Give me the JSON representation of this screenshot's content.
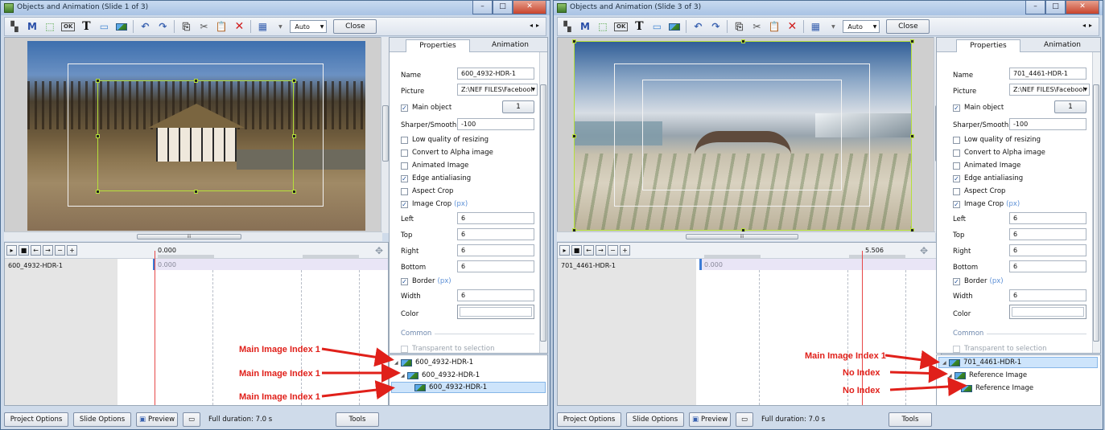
{
  "windows": [
    {
      "title": "Objects and Animation (Slide 1 of 3)",
      "toolbar": {
        "m_label": "M",
        "t_label": "T",
        "zoom_value": "Auto",
        "close_label": "Close"
      },
      "tabs": {
        "properties": "Properties",
        "animation": "Animation"
      },
      "props": {
        "name_label": "Name",
        "name_value": "600_4932-HDR-1",
        "picture_label": "Picture",
        "picture_value": "Z:\\NEF FILES\\Facebool",
        "main_object_label": "Main object",
        "main_object_index": "1",
        "sharper_label": "Sharper/Smooth...",
        "sharper_value": "-100",
        "low_quality": "Low quality of resizing",
        "convert_alpha": "Convert to Alpha image",
        "animated_image": "Animated Image",
        "edge_antialiasing": "Edge antialiasing",
        "aspect_crop": "Aspect Crop",
        "image_crop": "Image Crop",
        "px1": "(px)",
        "left_label": "Left",
        "left_value": "6",
        "top_label": "Top",
        "top_value": "6",
        "right_label": "Right",
        "right_value": "6",
        "bottom_label": "Bottom",
        "bottom_value": "6",
        "border_label": "Border",
        "px2": "(px)",
        "width_label": "Width",
        "width_value": "6",
        "color_label": "Color",
        "common_label": "Common",
        "transparent": "Transparent to selection"
      },
      "timeline": {
        "time": "0.000",
        "track_name": "600_4932-HDR-1",
        "track_time": "0.000"
      },
      "tree": [
        "600_4932-HDR-1",
        "600_4932-HDR-1",
        "600_4932-HDR-1"
      ],
      "annotations": [
        "Main Image Index 1",
        "Main Image Index 1",
        "Main Image Index 1"
      ],
      "bottom": {
        "project_options": "Project Options",
        "slide_options": "Slide Options",
        "preview": "Preview",
        "duration": "Full duration: 7.0 s",
        "tools": "Tools"
      }
    },
    {
      "title": "Objects and Animation (Slide 3 of 3)",
      "toolbar": {
        "m_label": "M",
        "t_label": "T",
        "zoom_value": "Auto",
        "close_label": "Close"
      },
      "tabs": {
        "properties": "Properties",
        "animation": "Animation"
      },
      "props": {
        "name_label": "Name",
        "name_value": "701_4461-HDR-1",
        "picture_label": "Picture",
        "picture_value": "Z:\\NEF FILES\\Facebool",
        "main_object_label": "Main object",
        "main_object_index": "1",
        "sharper_label": "Sharper/Smooth...",
        "sharper_value": "-100",
        "low_quality": "Low quality of resizing",
        "convert_alpha": "Convert to Alpha image",
        "animated_image": "Animated Image",
        "edge_antialiasing": "Edge antialiasing",
        "aspect_crop": "Aspect Crop",
        "image_crop": "Image Crop",
        "px1": "(px)",
        "left_label": "Left",
        "left_value": "6",
        "top_label": "Top",
        "top_value": "6",
        "right_label": "Right",
        "right_value": "6",
        "bottom_label": "Bottom",
        "bottom_value": "6",
        "border_label": "Border",
        "px2": "(px)",
        "width_label": "Width",
        "width_value": "6",
        "color_label": "Color",
        "common_label": "Common",
        "transparent": "Transparent to selection"
      },
      "timeline": {
        "time": "5.506",
        "track_name": "701_4461-HDR-1",
        "track_time": "0.000"
      },
      "tree": [
        "701_4461-HDR-1",
        "Reference Image",
        "Reference Image"
      ],
      "annotations": [
        "Main Image Index 1",
        "No Index",
        "No Index"
      ],
      "bottom": {
        "project_options": "Project Options",
        "slide_options": "Slide Options",
        "preview": "Preview",
        "duration": "Full duration: 7.0 s",
        "tools": "Tools"
      }
    }
  ],
  "colors": {
    "selection": "#b6e03a",
    "annotation": "#e0201a",
    "playhead": "#e74848"
  }
}
